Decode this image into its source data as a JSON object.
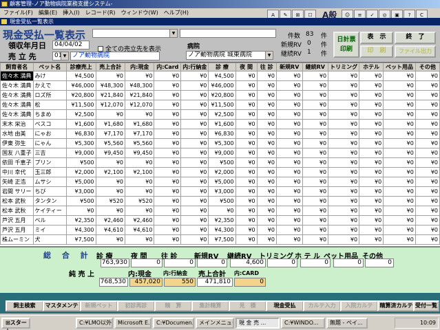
{
  "window_title": "顧客管理-ノア動物病院業務支援システム-",
  "menu": [
    "ファイル(F)",
    "編集(E)",
    "挿入(I)",
    "レコード(R)",
    "ウィンドウ(W)",
    "ヘルプ(H)"
  ],
  "toolbar_text": "A般",
  "subwindow_title": "現金受払一覧表示",
  "form": {
    "title": "現金受払一覧表示",
    "date_label": "領収年月日",
    "date_value": "04/04/02",
    "checkbox_label": "全ての売立先を表示",
    "seller_label": "売 立 先",
    "seller_code": "01",
    "seller_name": "ノア動物病院",
    "hospital_label": "病院",
    "hospital_value": "ノア動物病院 城東病院",
    "count_label": "件数",
    "count_value": "83",
    "count_unit": "件",
    "new_rv_label": "新規RV",
    "new_rv_value": "0",
    "new_rv_unit": "件",
    "cont_rv_label": "継続RV",
    "cont_rv_value": "1",
    "cont_rv_unit": "件"
  },
  "buttons": {
    "daily": "日計票\n印刷",
    "display": "表　示",
    "end": "終　了",
    "print": "印　刷",
    "file": "ファイル出力"
  },
  "table": {
    "columns": [
      "飼育者名",
      "ペット名",
      "診療売上",
      "売上合計",
      "内:現金",
      "内:Card",
      "内:行納金",
      "診 療",
      "夜 間",
      "往 診",
      "新規RV",
      "継続RV",
      "トリミング",
      "ホテル",
      "ペット用品",
      "その他"
    ],
    "rows": [
      [
        "佐々木 満典",
        "みけ",
        "¥4,500",
        "¥0",
        "¥0",
        "¥0",
        "¥0",
        "¥4,500",
        "¥0",
        "¥0",
        "¥0",
        "¥0",
        "¥0",
        "¥0",
        "¥0",
        "¥0"
      ],
      [
        "佐々木 満典",
        "かえで",
        "¥46,000",
        "¥48,300",
        "¥48,300",
        "¥0",
        "¥0",
        "¥46,000",
        "¥0",
        "¥0",
        "¥0",
        "¥0",
        "¥0",
        "¥0",
        "¥0",
        "¥0"
      ],
      [
        "佐々木 満典",
        "ロズ所",
        "¥20,800",
        "¥21,840",
        "¥21,840",
        "¥0",
        "¥0",
        "¥20,800",
        "¥0",
        "¥0",
        "¥0",
        "¥0",
        "¥0",
        "¥0",
        "¥0",
        "¥0"
      ],
      [
        "佐々木 満典",
        "松",
        "¥11,500",
        "¥12,070",
        "¥12,070",
        "¥0",
        "¥0",
        "¥11,500",
        "¥0",
        "¥0",
        "¥0",
        "¥0",
        "¥0",
        "¥0",
        "¥0",
        "¥0"
      ],
      [
        "佐々木 満典",
        "ちまめ",
        "¥2,500",
        "¥0",
        "¥0",
        "¥0",
        "¥0",
        "¥2,500",
        "¥0",
        "¥0",
        "¥0",
        "¥0",
        "¥0",
        "¥0",
        "¥0",
        "¥0"
      ],
      [
        "末木 栄治",
        "ペスコ",
        "¥1,600",
        "¥1,680",
        "¥1,680",
        "¥0",
        "¥0",
        "¥1,600",
        "¥0",
        "¥0",
        "¥0",
        "¥0",
        "¥0",
        "¥0",
        "¥0",
        "¥0"
      ],
      [
        "水地 由美",
        "にゃお",
        "¥6,830",
        "¥7,170",
        "¥7,170",
        "¥0",
        "¥0",
        "¥6,830",
        "¥0",
        "¥0",
        "¥0",
        "¥0",
        "¥0",
        "¥0",
        "¥0",
        "¥0"
      ],
      [
        "伊東 弥生",
        "にゃん",
        "¥5,300",
        "¥5,560",
        "¥5,560",
        "¥0",
        "¥0",
        "¥5,300",
        "¥0",
        "¥0",
        "¥0",
        "¥0",
        "¥0",
        "¥0",
        "¥0",
        "¥0"
      ],
      [
        "国友 八重子",
        "三吉",
        "¥9,000",
        "¥9,450",
        "¥9,450",
        "¥0",
        "¥0",
        "¥9,000",
        "¥0",
        "¥0",
        "¥0",
        "¥0",
        "¥0",
        "¥0",
        "¥0",
        "¥0"
      ],
      [
        "依田 千恵子",
        "プリン",
        "¥500",
        "¥0",
        "¥0",
        "¥0",
        "¥0",
        "¥500",
        "¥0",
        "¥0",
        "¥0",
        "¥0",
        "¥0",
        "¥0",
        "¥0",
        "¥0"
      ],
      [
        "中川 幸代",
        "玉三郎",
        "¥2,000",
        "¥2,100",
        "¥2,100",
        "¥0",
        "¥0",
        "¥2,000",
        "¥0",
        "¥0",
        "¥0",
        "¥0",
        "¥0",
        "¥0",
        "¥0",
        "¥0"
      ],
      [
        "矢崎 正浩",
        "ムサシ",
        "¥5,000",
        "¥0",
        "¥0",
        "¥0",
        "¥0",
        "¥5,000",
        "¥0",
        "¥0",
        "¥0",
        "¥0",
        "¥0",
        "¥0",
        "¥0",
        "¥0"
      ],
      [
        "岩間 サリー",
        "ちび",
        "¥3,000",
        "¥0",
        "¥0",
        "¥0",
        "¥0",
        "¥3,000",
        "¥0",
        "¥0",
        "¥0",
        "¥0",
        "¥0",
        "¥0",
        "¥0",
        "¥0"
      ],
      [
        "松本 武秋",
        "タンタン",
        "¥500",
        "¥520",
        "¥520",
        "¥0",
        "¥0",
        "¥500",
        "¥0",
        "¥0",
        "¥0",
        "¥0",
        "¥0",
        "¥0",
        "¥0",
        "¥0"
      ],
      [
        "松本 武秋",
        "ケイティー",
        "¥0",
        "¥0",
        "¥0",
        "¥0",
        "¥0",
        "¥0",
        "¥0",
        "¥0",
        "¥0",
        "¥0",
        "¥0",
        "¥0",
        "¥0",
        "¥0"
      ],
      [
        "芦沢 五月",
        "ベル",
        "¥2,350",
        "¥2,460",
        "¥2,460",
        "¥0",
        "¥0",
        "¥2,350",
        "¥0",
        "¥0",
        "¥0",
        "¥0",
        "¥0",
        "¥0",
        "¥0",
        "¥0"
      ],
      [
        "芦沢 五月",
        "ミイ",
        "¥4,300",
        "¥4,610",
        "¥4,610",
        "¥0",
        "¥0",
        "¥4,300",
        "¥0",
        "¥0",
        "¥0",
        "¥0",
        "¥0",
        "¥0",
        "¥0",
        "¥0"
      ],
      [
        "株ムーミン",
        "犬",
        "¥7,500",
        "¥0",
        "¥0",
        "¥0",
        "¥0",
        "¥7,500",
        "¥0",
        "¥0",
        "¥0",
        "¥0",
        "¥0",
        "¥0",
        "¥0",
        "¥0"
      ]
    ]
  },
  "summary": {
    "title": "総 合 計",
    "headers": [
      "診 療",
      "夜 間",
      "往 診",
      "新規RV",
      "継続RV",
      "トリミング",
      "ホ テ ル",
      "ペット用品",
      "その他"
    ],
    "values": [
      "763,930",
      "0",
      "0",
      "0",
      "4,600",
      "0",
      "0",
      "0",
      "0"
    ],
    "net_sales_label": "純 売 上",
    "net_sales_value": "768,530",
    "cash_label": "内:現金",
    "cash_value": "457,020",
    "levy_label": "内:行納金",
    "levy_value": "550",
    "total_label": "売上合計",
    "total_value": "471,810",
    "card_label": "内:CARD",
    "card_value": "0"
  },
  "tabs": [
    "飼主検索",
    "マスタメンテ",
    "新規ペット",
    "初診再診",
    "精　算",
    "集計精算",
    "見　積",
    "現金受払",
    "カルテ入力",
    "入院カルテ",
    "精算済カルテ",
    "受付一覧"
  ],
  "taskbar": {
    "start": "スタート",
    "tasks": [
      "C:¥LMO以外...",
      "Microsoft E...",
      "C:¥Documen...",
      "メインメニュー",
      "現 金 売 ...",
      "C:¥WINDO...",
      "無題 - ペイ..."
    ],
    "clock": "10:09"
  }
}
